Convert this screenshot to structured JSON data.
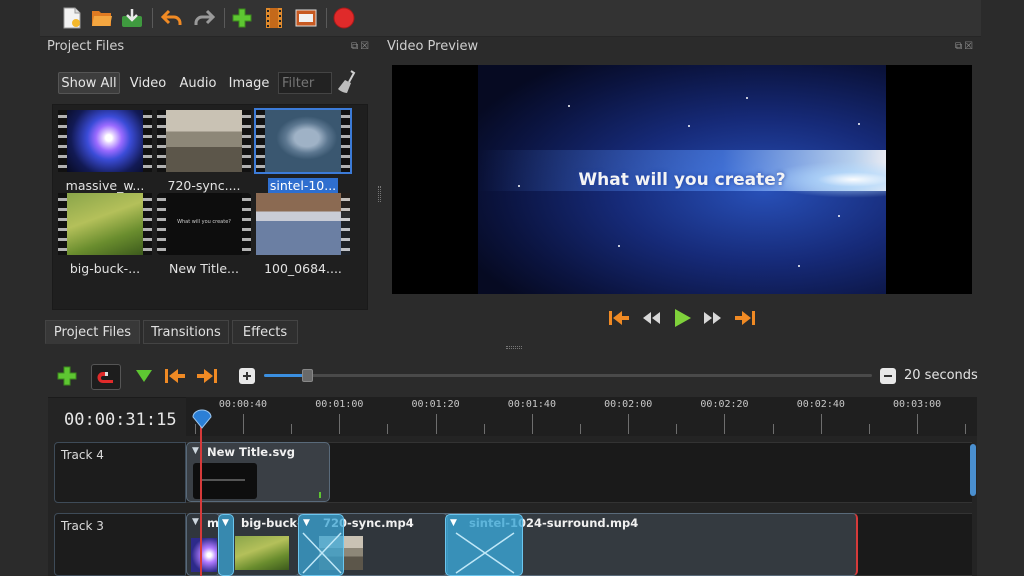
{
  "toolbar": {
    "buttons": [
      {
        "icon": "new-project-icon",
        "name": "new-project-button"
      },
      {
        "icon": "open-project-icon",
        "name": "open-project-button"
      },
      {
        "icon": "save-project-icon",
        "name": "save-project-button"
      },
      {
        "icon": "undo-icon",
        "name": "undo-button"
      },
      {
        "icon": "redo-icon",
        "name": "redo-button"
      },
      {
        "icon": "import-files-icon",
        "name": "import-files-button"
      },
      {
        "icon": "choose-profile-icon",
        "name": "choose-profile-button"
      },
      {
        "icon": "fullscreen-icon",
        "name": "fullscreen-button"
      },
      {
        "icon": "export-video-icon",
        "name": "export-video-button"
      }
    ]
  },
  "project_files": {
    "title": "Project Files",
    "filters": {
      "show_all": "Show All",
      "video": "Video",
      "audio": "Audio",
      "image": "Image",
      "filter_placeholder": "Filter"
    },
    "files": [
      {
        "label": "massive_w...",
        "selected": false
      },
      {
        "label": "720-sync....",
        "selected": false
      },
      {
        "label": "sintel-10...",
        "selected": true
      },
      {
        "label": "big-buck-...",
        "selected": false
      },
      {
        "label": "New Title...",
        "selected": false
      },
      {
        "label": "100_0684....",
        "selected": false
      }
    ],
    "title_thumb_text": "What will you create?"
  },
  "tabs": {
    "project_files": "Project Files",
    "transitions": "Transitions",
    "effects": "Effects"
  },
  "video_preview": {
    "title": "Video Preview",
    "overlay_text": "What will you create?"
  },
  "playback": {
    "buttons": [
      "jump-to-start",
      "rewind",
      "play",
      "fast-forward",
      "jump-to-end"
    ]
  },
  "timeline": {
    "zoom_label": "20 seconds",
    "zoom_fraction": 0.07,
    "timecode": "00:00:31:15",
    "ruler_labels": [
      "00:00:40",
      "00:01:00",
      "00:01:20",
      "00:01:40",
      "00:02:00",
      "00:02:20",
      "00:02:40",
      "00:03:00"
    ],
    "tracks": [
      {
        "name": "Track 4",
        "clips": [
          {
            "title": "New Title.svg"
          }
        ]
      },
      {
        "name": "Track 3",
        "clips": [
          {
            "title": "m"
          },
          {
            "title": "big-buck-"
          },
          {
            "title": "720-sync.mp4"
          },
          {
            "title": "sintel-1024-surround.mp4"
          }
        ]
      }
    ]
  },
  "colors": {
    "accent_orange": "#f08a24",
    "accent_green": "#4cc22a",
    "accent_red": "#e02a2a",
    "selection_blue": "#2f6fcf",
    "transition_blue": "#3aa6d6"
  }
}
